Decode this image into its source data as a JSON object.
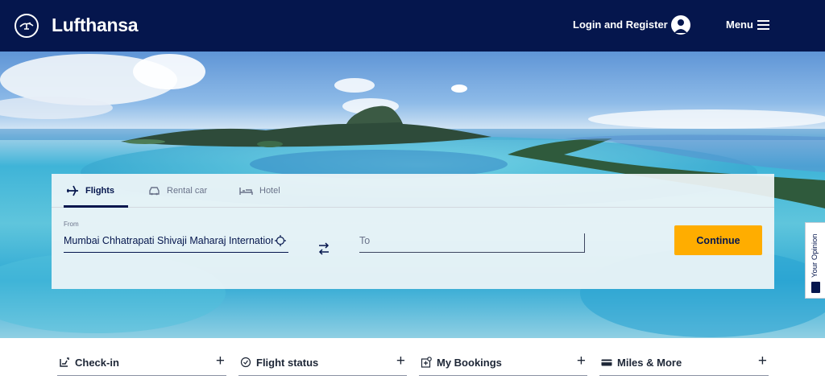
{
  "header": {
    "brand": "Lufthansa",
    "login_label": "Login and Register",
    "menu_label": "Menu",
    "background": "#05164d"
  },
  "booking": {
    "tabs": [
      {
        "label": "Flights",
        "icon": "plane-icon",
        "active": true
      },
      {
        "label": "Rental car",
        "icon": "car-icon",
        "active": false
      },
      {
        "label": "Hotel",
        "icon": "bed-icon",
        "active": false
      }
    ],
    "from_label": "From",
    "from_value": "Mumbai Chhatrapati Shivaji Maharaj International",
    "to_placeholder": "To",
    "continue_label": "Continue",
    "accent": "#ffad00"
  },
  "feedback": {
    "label": "Your Opinion"
  },
  "quick_links": [
    {
      "label": "Check-in",
      "icon": "checkin-icon"
    },
    {
      "label": "Flight status",
      "icon": "clock-icon"
    },
    {
      "label": "My Bookings",
      "icon": "booking-icon"
    },
    {
      "label": "Miles & More",
      "icon": "card-icon"
    }
  ]
}
